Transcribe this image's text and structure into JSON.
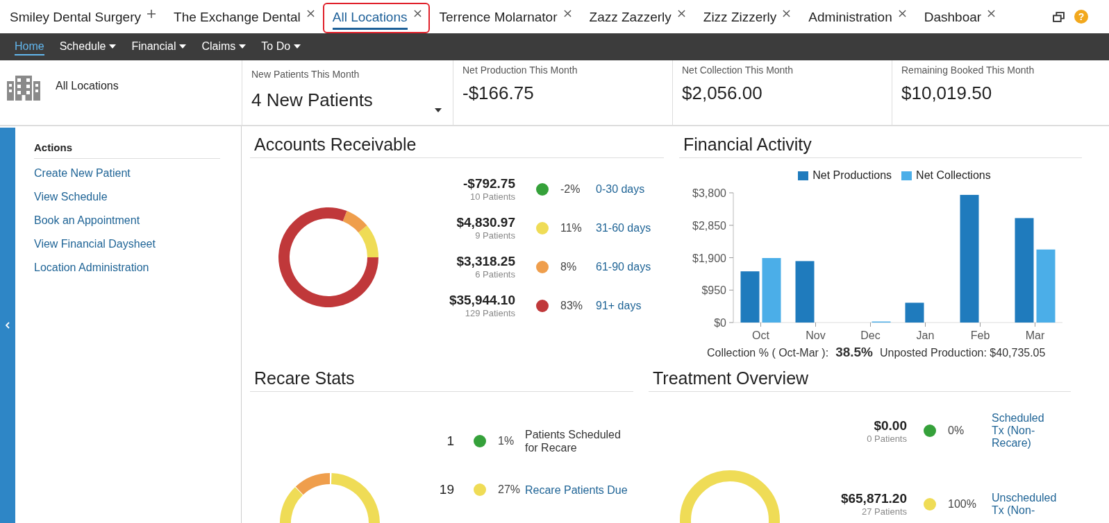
{
  "tabs": [
    {
      "label": "Smiley Dental Surgery",
      "kind": "add",
      "selected": false,
      "highlighted": false
    },
    {
      "label": "The Exchange Dental",
      "kind": "closable",
      "selected": false,
      "highlighted": false
    },
    {
      "label": "All Locations",
      "kind": "closable",
      "selected": true,
      "highlighted": true
    },
    {
      "label": "Terrence Molarnator",
      "kind": "closable",
      "selected": false,
      "highlighted": false
    },
    {
      "label": "Zazz Zazzerly",
      "kind": "closable",
      "selected": false,
      "highlighted": false
    },
    {
      "label": "Zizz Zizzerly",
      "kind": "closable",
      "selected": false,
      "highlighted": false
    },
    {
      "label": "Administration",
      "kind": "closable",
      "selected": false,
      "highlighted": false
    },
    {
      "label": "Dashboar",
      "kind": "closable",
      "selected": false,
      "highlighted": false
    }
  ],
  "help_label": "?",
  "nav": [
    {
      "label": "Home",
      "dropdown": false,
      "selected": true
    },
    {
      "label": "Schedule",
      "dropdown": true,
      "selected": false
    },
    {
      "label": "Financial",
      "dropdown": true,
      "selected": false
    },
    {
      "label": "Claims",
      "dropdown": true,
      "selected": false
    },
    {
      "label": "To Do",
      "dropdown": true,
      "selected": false
    }
  ],
  "location": "All Locations",
  "stats": [
    {
      "label": "New Patients This Month",
      "value": "4 New Patients",
      "dropdown": true
    },
    {
      "label": "Net Production This Month",
      "value": "-$166.75",
      "dropdown": false
    },
    {
      "label": "Net Collection This Month",
      "value": "$2,056.00",
      "dropdown": false
    },
    {
      "label": "Remaining Booked This Month",
      "value": "$10,019.50",
      "dropdown": false
    }
  ],
  "actions": {
    "title": "Actions",
    "links": [
      "Create New Patient",
      "View Schedule",
      "Book an Appointment",
      "View Financial Daysheet",
      "Location Administration"
    ]
  },
  "accounts_receivable": {
    "title": "Accounts Receivable",
    "rows": [
      {
        "amount": "-$792.75",
        "patients": "10 Patients",
        "color": "#35a13a",
        "percent": "-2%",
        "period": "0-30 days"
      },
      {
        "amount": "$4,830.97",
        "patients": "9 Patients",
        "color": "#efdc56",
        "percent": "11%",
        "period": "31-60 days"
      },
      {
        "amount": "$3,318.25",
        "patients": "6 Patients",
        "color": "#ef9e4c",
        "percent": "8%",
        "period": "61-90 days"
      },
      {
        "amount": "$35,944.10",
        "patients": "129 Patients",
        "color": "#c0383a",
        "percent": "83%",
        "period": "91+ days"
      }
    ]
  },
  "financial_activity": {
    "title": "Financial Activity",
    "chart_data": {
      "type": "bar",
      "categories": [
        "Oct",
        "Nov",
        "Dec",
        "Jan",
        "Feb",
        "Mar"
      ],
      "ylim": [
        0,
        3800
      ],
      "yticks": [
        {
          "value": 0,
          "label": "$0"
        },
        {
          "value": 950,
          "label": "$950"
        },
        {
          "value": 1900,
          "label": "$1,900"
        },
        {
          "value": 2850,
          "label": "$2,850"
        },
        {
          "value": 3800,
          "label": "$3,800"
        }
      ],
      "series": [
        {
          "name": "Net Productions",
          "color": "#1f7bbd",
          "values": [
            1500,
            1800,
            0,
            580,
            3740,
            3060
          ]
        },
        {
          "name": "Net Collections",
          "color": "#4baee8",
          "values": [
            1890,
            0,
            30,
            0,
            0,
            2140
          ]
        }
      ]
    },
    "collection_label": "Collection % ( Oct-Mar ):",
    "collection_value": "38.5%",
    "unposted": "Unposted Production: $40,735.05"
  },
  "recare_stats": {
    "title": "Recare Stats",
    "rows": [
      {
        "count": "1",
        "color": "#35a13a",
        "percent": "1%",
        "label": "Patients Scheduled for Recare",
        "kind": "text"
      },
      {
        "count": "19",
        "color": "#efdc56",
        "percent": "27%",
        "label": "Recare Patients Due",
        "kind": "link"
      }
    ]
  },
  "treatment_overview": {
    "title": "Treatment Overview",
    "rows": [
      {
        "amount": "$0.00",
        "patients": "0 Patients",
        "color": "#35a13a",
        "percent": "0%",
        "label": "Scheduled Tx (Non-Recare)"
      },
      {
        "amount": "$65,871.20",
        "patients": "27 Patients",
        "color": "#efdc56",
        "percent": "100%",
        "label": "Unscheduled Tx (Non-"
      }
    ]
  }
}
